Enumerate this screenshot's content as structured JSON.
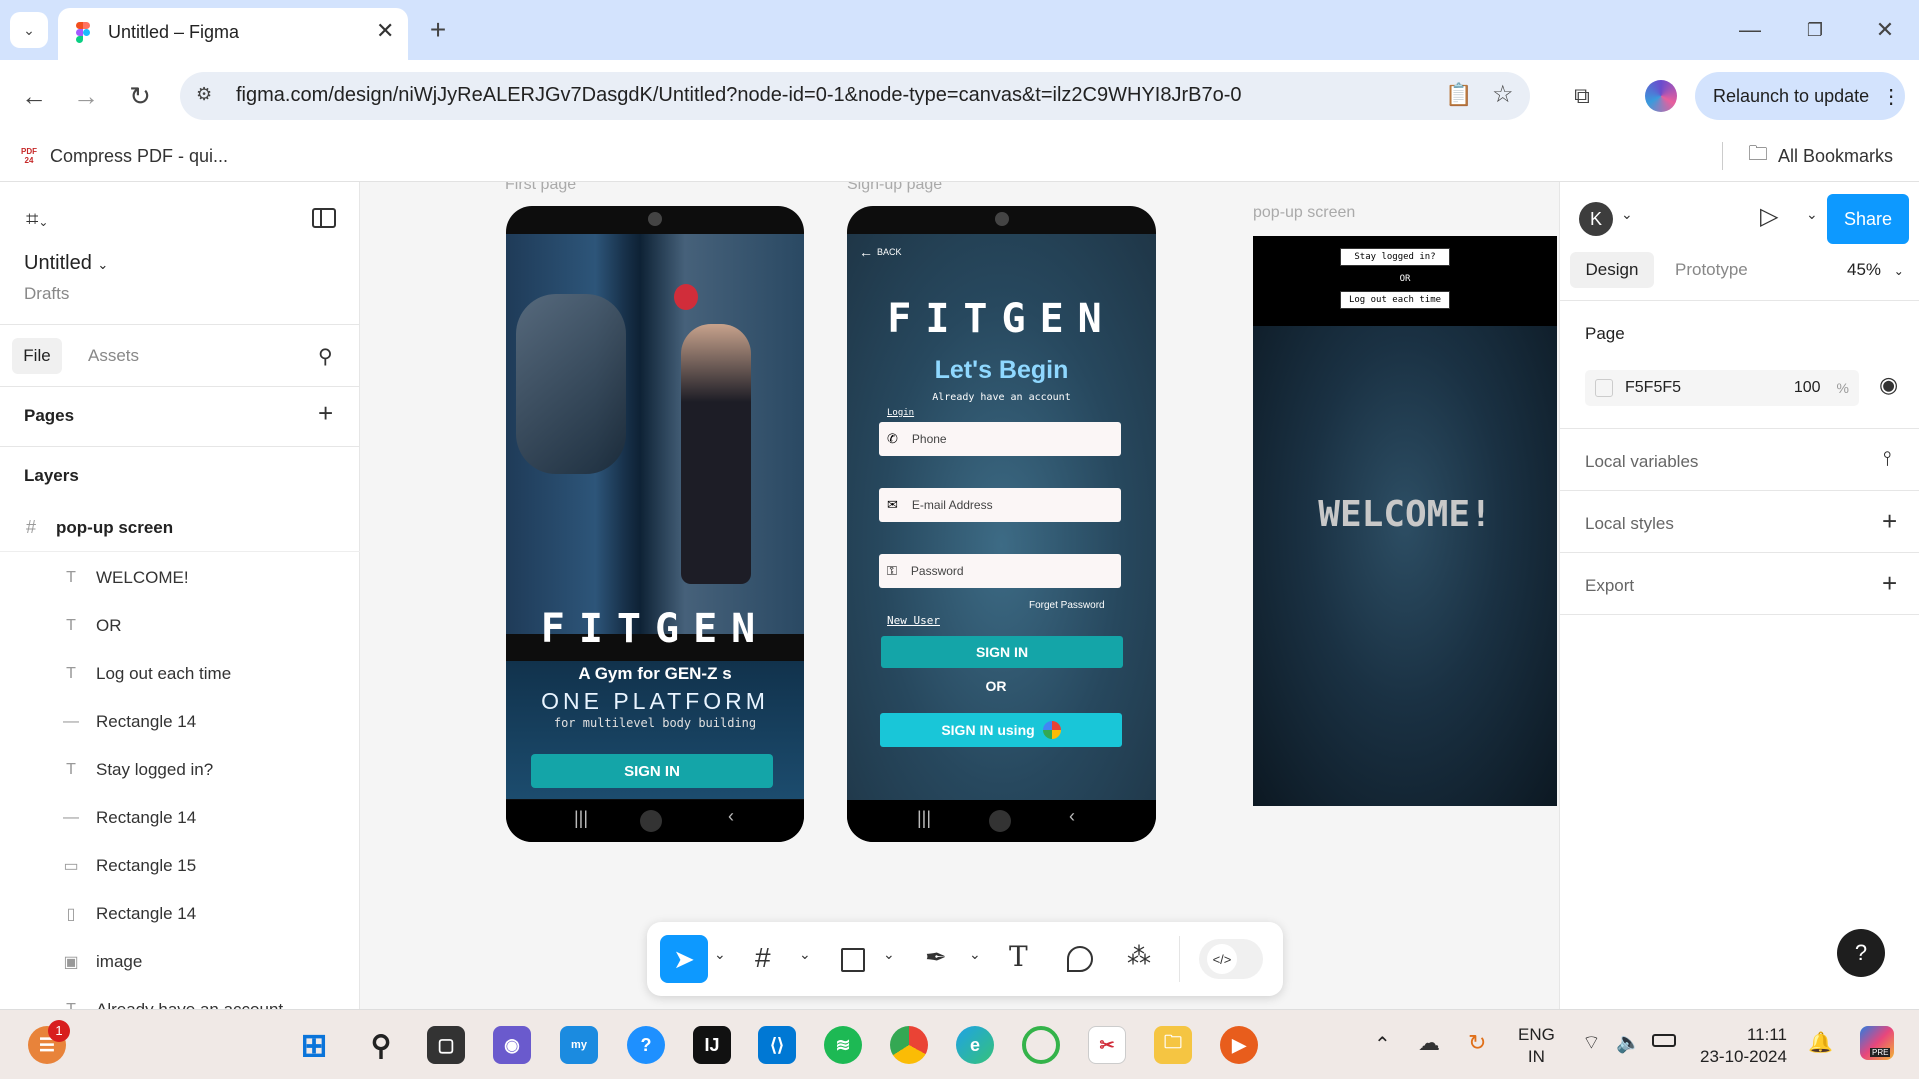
{
  "browser": {
    "tab_title": "Untitled – Figma",
    "url": "figma.com/design/niWjJyReALERJGv7DasgdK/Untitled?node-id=0-1&node-type=canvas&t=ilz2C9WHYI8JrB7o-0",
    "relaunch_label": "Relaunch to update",
    "bookmark": "Compress PDF - qui...",
    "bookmark_icon_text": "PDF 24",
    "all_bookmarks": "All Bookmarks"
  },
  "figma": {
    "file_name": "Untitled",
    "location": "Drafts",
    "tabs": [
      "File",
      "Assets"
    ],
    "pages_label": "Pages",
    "layers_label": "Layers",
    "frame": "pop-up screen",
    "layers": [
      {
        "icon": "T",
        "label": "WELCOME!"
      },
      {
        "icon": "T",
        "label": "OR"
      },
      {
        "icon": "T",
        "label": "Log out each time"
      },
      {
        "icon": "—",
        "label": "Rectangle 14"
      },
      {
        "icon": "T",
        "label": "Stay logged in?"
      },
      {
        "icon": "—",
        "label": "Rectangle 14"
      },
      {
        "icon": "▭",
        "label": "Rectangle 15"
      },
      {
        "icon": "▯",
        "label": "Rectangle 14"
      },
      {
        "icon": "▣",
        "label": "image"
      },
      {
        "icon": "T",
        "label": "Already have an account"
      }
    ],
    "right": {
      "avatar": "K",
      "share": "Share",
      "tab_design": "Design",
      "tab_prototype": "Prototype",
      "zoom": "45%",
      "page_label": "Page",
      "page_color": "F5F5F5",
      "opacity": "100",
      "opacity_unit": "%",
      "local_variables": "Local variables",
      "local_styles": "Local styles",
      "export": "Export"
    },
    "help": "?"
  },
  "canvas": {
    "first_label": "First page",
    "signup_label": "Sign-up page",
    "popup_label": "pop-up screen",
    "first": {
      "brand": "FITGEN",
      "tagline": "A Gym for GEN-Z s",
      "platform": "ONE PLATFORM",
      "sub": "for multilevel body building",
      "signin": "SIGN IN"
    },
    "signup": {
      "back": "BACK",
      "brand": "FITGEN",
      "heading": "Let's Begin",
      "sub": "Already have an account",
      "login": "Login",
      "phone": "Phone",
      "email": "E-mail Address",
      "password": "Password",
      "forget": "Forget Password",
      "new_user": "New User",
      "signin": "SIGN IN",
      "or": "OR",
      "signin_using": "SIGN IN using"
    },
    "popup": {
      "stay": "Stay logged in?",
      "or": "OR",
      "logout": "Log out each time",
      "welcome": "WELCOME!"
    }
  },
  "taskbar": {
    "badge": "1",
    "lang1": "ENG",
    "lang2": "IN",
    "time": "11:11",
    "date": "23-10-2024",
    "pre": "PRE"
  }
}
